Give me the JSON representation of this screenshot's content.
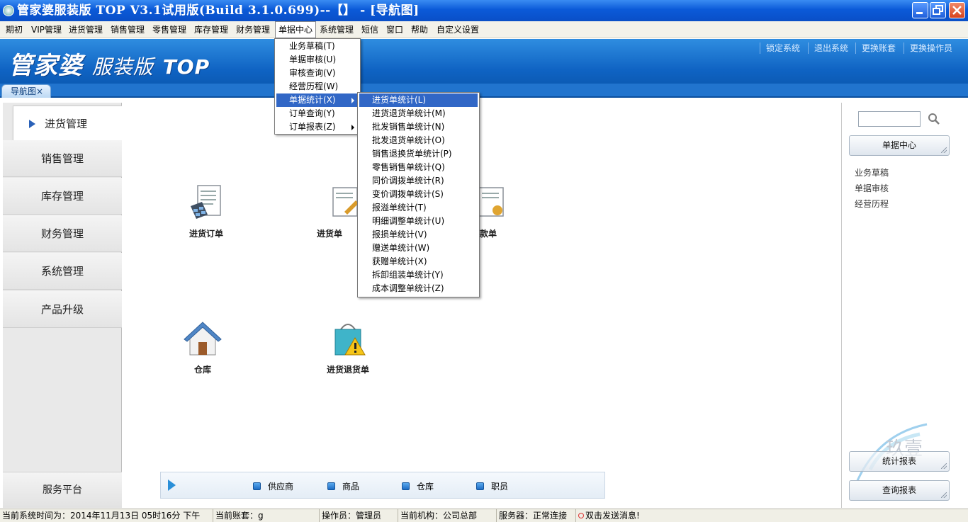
{
  "window": {
    "title": "管家婆服装版 TOP V3.1试用版(Build 3.1.0.699)--【】 - [导航图]"
  },
  "menubar": [
    {
      "label": "期初"
    },
    {
      "label": "VIP管理"
    },
    {
      "label": "进货管理"
    },
    {
      "label": "销售管理"
    },
    {
      "label": "零售管理"
    },
    {
      "label": "库存管理"
    },
    {
      "label": "财务管理"
    },
    {
      "label": "单据中心"
    },
    {
      "label": "系统管理"
    },
    {
      "label": "短信"
    },
    {
      "label": "窗口"
    },
    {
      "label": "帮助"
    },
    {
      "label": "自定义设置"
    }
  ],
  "banner": {
    "logo_main": "管家婆",
    "logo_sub": "服装版",
    "logo_top": "TOP",
    "links": [
      "锁定系统",
      "退出系统",
      "更换账套",
      "更换操作员"
    ]
  },
  "tabs": {
    "nav_tab": "导航图",
    "close_glyph": "×"
  },
  "leftnav": {
    "items": [
      "进货管理",
      "销售管理",
      "库存管理",
      "财务管理",
      "系统管理",
      "产品升级"
    ],
    "platform": "服务平台"
  },
  "main": {
    "tiles": [
      "进货订单",
      "进货单",
      "付款单",
      "仓库",
      "进货退货单"
    ]
  },
  "quickbar": {
    "links": [
      "供应商",
      "商品",
      "仓库",
      "职员"
    ]
  },
  "rightpanel": {
    "search_value": "",
    "center_button": "单据中心",
    "links": [
      "业务草稿",
      "单据审核",
      "经营历程"
    ],
    "stat_button": "统计报表",
    "query_button": "查询报表",
    "watermark_text": "玖壹"
  },
  "menu_documents": {
    "items": [
      "业务草稿(T)",
      "单据审核(U)",
      "审核查询(V)",
      "经营历程(W)",
      "单据统计(X)",
      "订单查询(Y)",
      "订单报表(Z)"
    ]
  },
  "submenu_stats": {
    "items": [
      "进货单统计(L)",
      "进货退货单统计(M)",
      "批发销售单统计(N)",
      "批发退货单统计(O)",
      "销售退换货单统计(P)",
      "零售销售单统计(Q)",
      "同价调拨单统计(R)",
      "变价调拨单统计(S)",
      "报溢单统计(T)",
      "明细调整单统计(U)",
      "报损单统计(V)",
      "赠送单统计(W)",
      "获赠单统计(X)",
      "拆卸组装单统计(Y)",
      "成本调整单统计(Z)"
    ]
  },
  "statusbar": {
    "time": "当前系统时间为：2014年11月13日 05时16分 下午",
    "account": "当前账套：g",
    "operator": "操作员：管理员",
    "org": "当前机构：公司总部",
    "server": "服务器：正常连接",
    "message": "双击发送消息!"
  },
  "colors": {
    "title_blue": "#0b5ad8",
    "banner_blue": "#0f63c3",
    "menu_highlight": "#3167c6"
  }
}
